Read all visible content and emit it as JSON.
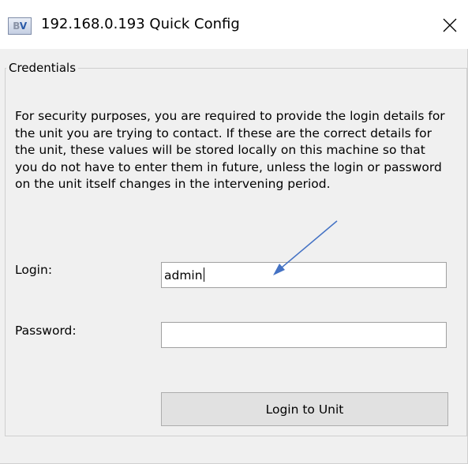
{
  "window": {
    "title": "192.168.0.193 Quick Config",
    "icon_name": "bv-app-icon",
    "close_glyph": "✕"
  },
  "credentials": {
    "group_label": "Credentials",
    "info_text": "For security purposes, you are required to provide the login details for the unit you are trying to contact. If these are the correct details for the unit, these values will be stored locally on this machine so that you do not have to enter them in future, unless the login or password on the unit itself changes in the intervening period.",
    "login_label": "Login:",
    "login_value": "admin",
    "password_label": "Password:",
    "password_value": "",
    "submit_label": "Login to Unit"
  },
  "annotation": {
    "type": "arrow",
    "color": "#4472c4"
  }
}
